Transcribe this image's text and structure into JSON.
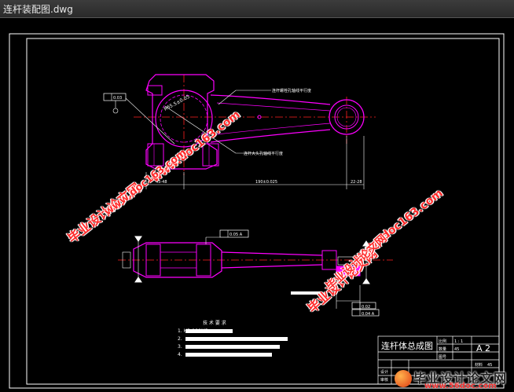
{
  "window": {
    "title": "连杆装配图.dwg"
  },
  "colors": {
    "frame": "#ffffff",
    "part": "#ff00ff",
    "center": "#ff2020",
    "dim": "#ffffff",
    "annot": "#ffff00",
    "watermark": "#ff2a2a"
  },
  "drawing": {
    "top_view": {
      "radius_label": "R65.5±0.05",
      "note_upper": "连杆螺栓孔轴线平行度",
      "note_lower": "连杆大头孔轴线平行度",
      "dim_left": "43-48",
      "dim_mid": "190±0.025",
      "dim_right": "22-28",
      "tol_left": "0.03"
    },
    "side_view": {
      "tol_box_top": "0.05 A",
      "tol_box_right1": "0.02",
      "tol_box_right2": "0.04 A"
    },
    "tech_req": {
      "heading": "技 术 要 求",
      "lines": [
        "1. HB-180MPa",
        "2.",
        "3.",
        "4."
      ]
    },
    "title_block": {
      "name": "连杆体总成图",
      "scale_label": "比例",
      "scale_value": "1 : 1",
      "size": "A 2",
      "row2_label": "数量",
      "row2_value": "45",
      "row3_label": "图号",
      "row4_left": "设计",
      "row5_left": "审核",
      "material_label": "材料",
      "material_value": "45"
    }
  },
  "watermarks": {
    "site1": "www.doc163.com",
    "site2": "毕业设计论文网",
    "site3": "www.doc163.com",
    "site4": "毕业设计论文网",
    "site5": "www.doc163.com",
    "site6": "毕业设计论文网",
    "footer_brand": "毕业设计论文网",
    "footer_site": "www.56doc.com"
  }
}
